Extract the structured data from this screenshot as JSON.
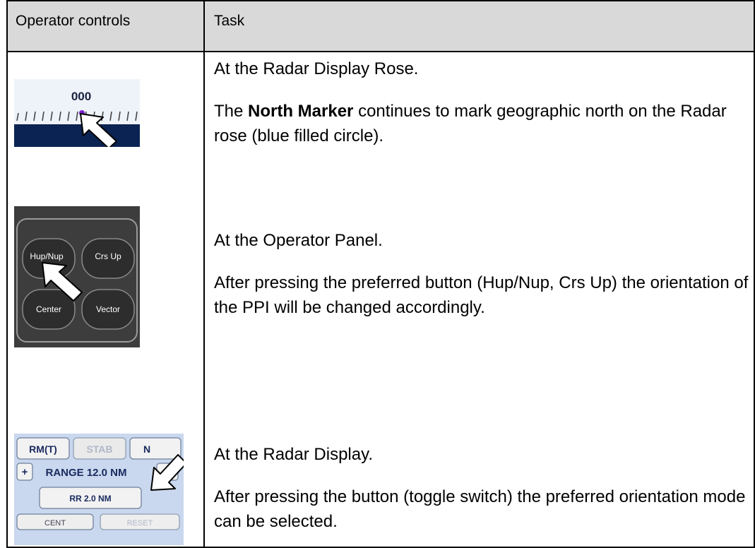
{
  "header": {
    "col1": "Operator controls",
    "col2": "Task"
  },
  "rows": [
    {
      "location": "At the Radar Display Rose.",
      "desc_pre": "The ",
      "desc_bold": "North Marker",
      "desc_post": " continues to mark geographic north on the Radar rose (blue filled circle).",
      "thumb": {
        "label": "000",
        "icon": "arrow-cursor-icon"
      }
    },
    {
      "location": "At the Operator Panel.",
      "desc": "After pressing the preferred button (Hup/Nup, Crs Up) the orientation of the PPI will be changed accordingly.",
      "thumb": {
        "btn1": "Hup/Nup",
        "btn2": "Crs Up",
        "btn3": "Center",
        "btn4": "Vector",
        "icon": "arrow-cursor-icon"
      }
    },
    {
      "location": "At the Radar Display.",
      "desc": "After pressing the button (toggle switch) the preferred orientation mode can be selected.",
      "thumb": {
        "b_rm": "RM(T)",
        "b_stab": "STAB",
        "b_n": "N",
        "b_plus": "+",
        "range": "RANGE 12.0 NM",
        "rr": "RR 2.0 NM",
        "cent": "CENT",
        "reset": "RESET",
        "icon": "arrow-cursor-icon"
      }
    }
  ],
  "colors": {
    "header_bg": "#d9d9d9",
    "north_marker": "#7a1fd0",
    "rose_band": "#0b2352",
    "panel_bg": "#3d3d3d"
  }
}
